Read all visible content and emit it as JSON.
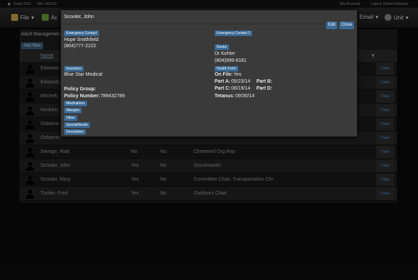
{
  "topbar": {
    "troop": "Troop 2112",
    "site": "Site: VA2112",
    "my_account": "[My Account]",
    "logout": "Logout: Robert.Edwards"
  },
  "navbar": {
    "file": "File",
    "activities": "Ac",
    "email": "Email",
    "unit": "Unit"
  },
  "section_title": "Adult Management",
  "add_new": "Add New",
  "table": {
    "name_header": "Name",
    "rows": [
      {
        "name": "Edwards",
        "c1": "",
        "c2": "",
        "position": "",
        "view": "View"
      },
      {
        "name": "Edwards,",
        "c1": "",
        "c2": "",
        "position": "",
        "view": "View"
      },
      {
        "name": "Mitchell,",
        "c1": "",
        "c2": "",
        "position": "",
        "view": "View"
      },
      {
        "name": "Neuben,",
        "c1": "",
        "c2": "",
        "position": "",
        "view": "View"
      },
      {
        "name": "Osborne,",
        "c1": "",
        "c2": "",
        "position": "",
        "view": "View"
      },
      {
        "name": "Osborne,",
        "c1": "",
        "c2": "",
        "position": "",
        "view": "View"
      },
      {
        "name": "Savage, Walt",
        "c1": "No",
        "c2": "No",
        "position": "Chartered Org Rep",
        "view": "View"
      },
      {
        "name": "Scouter, John",
        "c1": "Yes",
        "c2": "No",
        "position": "Scoutmaster",
        "view": "View"
      },
      {
        "name": "Scouter, Mary",
        "c1": "Yes",
        "c2": "No",
        "position": "Committee Chair, Transportation Chr",
        "view": "View"
      },
      {
        "name": "Tucker, Fred",
        "c1": "Yes",
        "c2": "No",
        "position": "Outdoors Chair",
        "view": "View"
      }
    ]
  },
  "modal": {
    "title": "Scouter, John",
    "edit": "Edit",
    "close": "Close",
    "labels": {
      "emergency_contact": "Emergency Contact",
      "emergency_contact_2": "Emergency Contact 2",
      "doctor": "Doctor",
      "insurance": "Insurance",
      "health_form": "Health Form",
      "medications": "Medications",
      "allergies": "Allergies",
      "other": "Other",
      "special_needs": "SpecialNeeds",
      "description": "Description"
    },
    "emergency_contact_name": "Hope Smithfield",
    "emergency_contact_phone": "(804)777-2222",
    "doctor_name": "Dr Kehler",
    "doctor_phone": "(804)999-8181",
    "insurance_name": "Blue Star Medical",
    "on_file_label": "On File:",
    "on_file_value": "Yes",
    "part_a_label": "Part A:",
    "part_a_value": "05/23/14",
    "part_b_label": "Part B:",
    "part_c_label": "Part C:",
    "part_c_value": "06/19/14",
    "part_d_label": "Part D:",
    "tetanus_label": "Tetanus:",
    "tetanus_value": "09/30/14",
    "policy_group_label": "Policy Group:",
    "policy_number_label": "Policy Number:",
    "policy_number_value": "789432789"
  }
}
